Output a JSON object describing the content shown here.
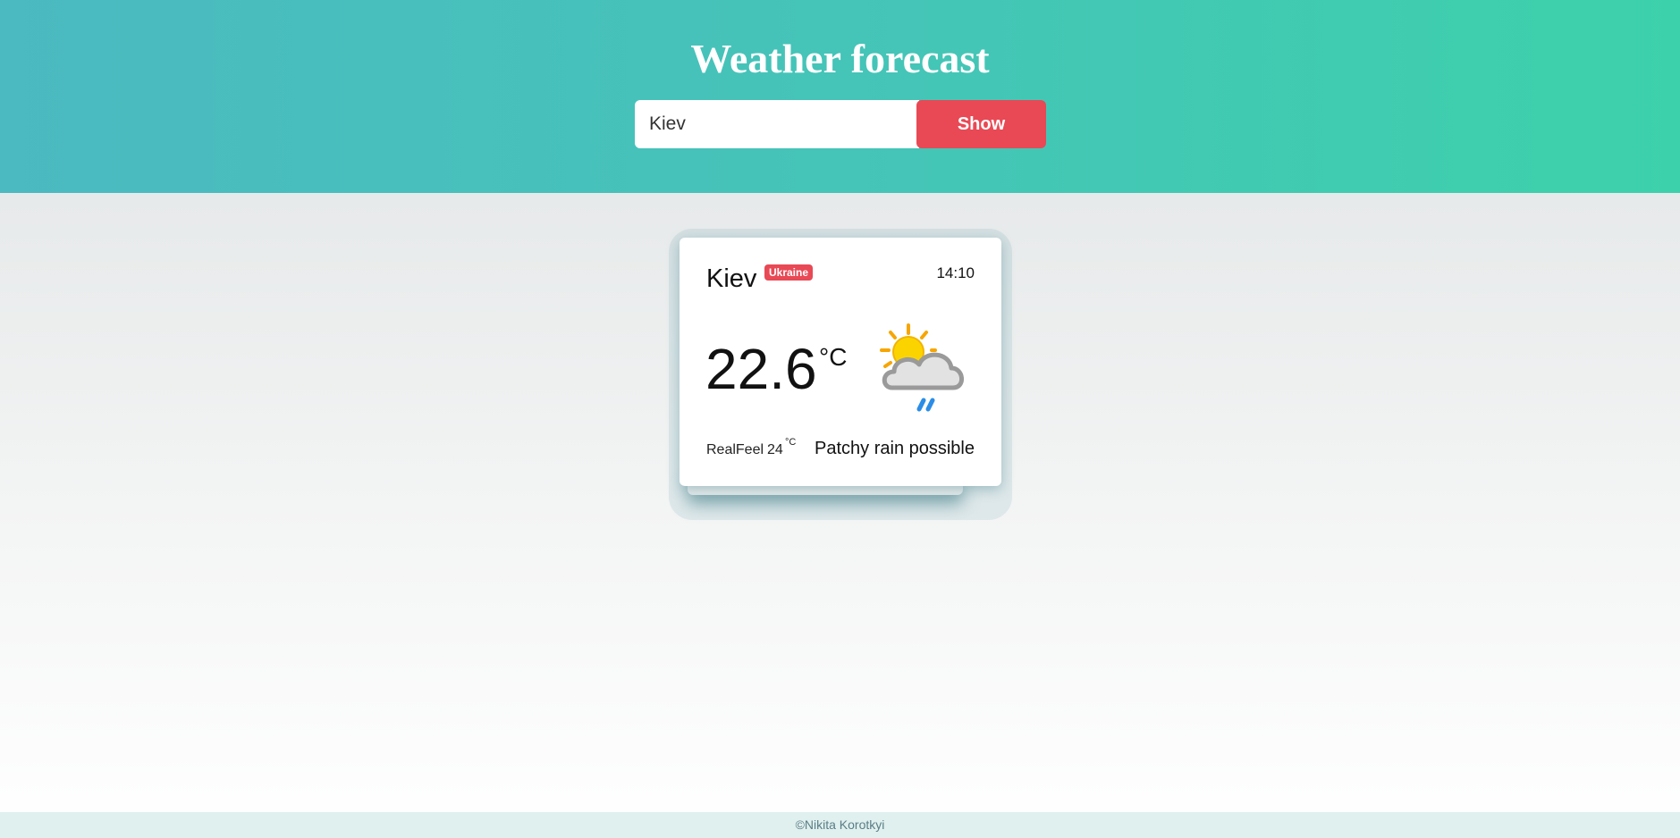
{
  "header": {
    "title": "Weather forecast",
    "search_value": "Kiev",
    "show_label": "Show"
  },
  "card": {
    "city": "Kiev",
    "country": "Ukraine",
    "time": "14:10",
    "temperature": "22.6",
    "temperature_unit": "°C",
    "realfeel_label": "RealFeel",
    "realfeel_value": "24",
    "realfeel_unit": "°C",
    "condition": "Patchy rain possible",
    "icon": "sun-cloud-rain-icon"
  },
  "footer": {
    "text": "©Nikita Korotkyi"
  },
  "colors": {
    "header_gradient_start": "#4bbac1",
    "header_gradient_end": "#3dd1ab",
    "accent": "#e84955"
  }
}
